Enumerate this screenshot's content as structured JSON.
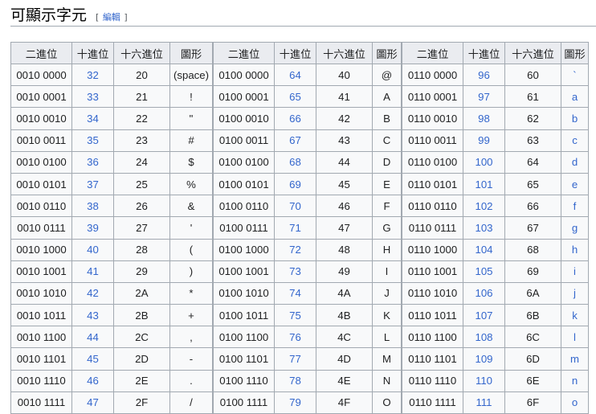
{
  "heading": {
    "title": "可顯示字元",
    "edit_open": "[",
    "edit_label": "編輯",
    "edit_close": "]"
  },
  "headers": [
    "二進位",
    "十進位",
    "十六進位",
    "圖形"
  ],
  "tables": [
    {
      "rows": [
        [
          "0010 0000",
          "32",
          "20",
          "(space)"
        ],
        [
          "0010 0001",
          "33",
          "21",
          "!"
        ],
        [
          "0010 0010",
          "34",
          "22",
          "\""
        ],
        [
          "0010 0011",
          "35",
          "23",
          "#"
        ],
        [
          "0010 0100",
          "36",
          "24",
          "$"
        ],
        [
          "0010 0101",
          "37",
          "25",
          "%"
        ],
        [
          "0010 0110",
          "38",
          "26",
          "&"
        ],
        [
          "0010 0111",
          "39",
          "27",
          "'"
        ],
        [
          "0010 1000",
          "40",
          "28",
          "("
        ],
        [
          "0010 1001",
          "41",
          "29",
          ")"
        ],
        [
          "0010 1010",
          "42",
          "2A",
          "*"
        ],
        [
          "0010 1011",
          "43",
          "2B",
          "+"
        ],
        [
          "0010 1100",
          "44",
          "2C",
          ","
        ],
        [
          "0010 1101",
          "45",
          "2D",
          "-"
        ],
        [
          "0010 1110",
          "46",
          "2E",
          "."
        ],
        [
          "0010 1111",
          "47",
          "2F",
          "/"
        ]
      ]
    },
    {
      "rows": [
        [
          "0100 0000",
          "64",
          "40",
          "@"
        ],
        [
          "0100 0001",
          "65",
          "41",
          "A"
        ],
        [
          "0100 0010",
          "66",
          "42",
          "B"
        ],
        [
          "0100 0011",
          "67",
          "43",
          "C"
        ],
        [
          "0100 0100",
          "68",
          "44",
          "D"
        ],
        [
          "0100 0101",
          "69",
          "45",
          "E"
        ],
        [
          "0100 0110",
          "70",
          "46",
          "F"
        ],
        [
          "0100 0111",
          "71",
          "47",
          "G"
        ],
        [
          "0100 1000",
          "72",
          "48",
          "H"
        ],
        [
          "0100 1001",
          "73",
          "49",
          "I"
        ],
        [
          "0100 1010",
          "74",
          "4A",
          "J"
        ],
        [
          "0100 1011",
          "75",
          "4B",
          "K"
        ],
        [
          "0100 1100",
          "76",
          "4C",
          "L"
        ],
        [
          "0100 1101",
          "77",
          "4D",
          "M"
        ],
        [
          "0100 1110",
          "78",
          "4E",
          "N"
        ],
        [
          "0100 1111",
          "79",
          "4F",
          "O"
        ]
      ]
    },
    {
      "rows": [
        [
          "0110 0000",
          "96",
          "60",
          "`"
        ],
        [
          "0110 0001",
          "97",
          "61",
          "a"
        ],
        [
          "0110 0010",
          "98",
          "62",
          "b"
        ],
        [
          "0110 0011",
          "99",
          "63",
          "c"
        ],
        [
          "0110 0100",
          "100",
          "64",
          "d"
        ],
        [
          "0110 0101",
          "101",
          "65",
          "e"
        ],
        [
          "0110 0110",
          "102",
          "66",
          "f"
        ],
        [
          "0110 0111",
          "103",
          "67",
          "g"
        ],
        [
          "0110 1000",
          "104",
          "68",
          "h"
        ],
        [
          "0110 1001",
          "105",
          "69",
          "i"
        ],
        [
          "0110 1010",
          "106",
          "6A",
          "j"
        ],
        [
          "0110 1011",
          "107",
          "6B",
          "k"
        ],
        [
          "0110 1100",
          "108",
          "6C",
          "l"
        ],
        [
          "0110 1101",
          "109",
          "6D",
          "m"
        ],
        [
          "0110 1110",
          "110",
          "6E",
          "n"
        ],
        [
          "0110 1111",
          "111",
          "6F",
          "o"
        ]
      ]
    }
  ],
  "colors": {
    "link": "#3366cc",
    "header_bg": "#eaecf0",
    "cell_bg": "#f8f9fa",
    "border": "#a2a9b1"
  }
}
